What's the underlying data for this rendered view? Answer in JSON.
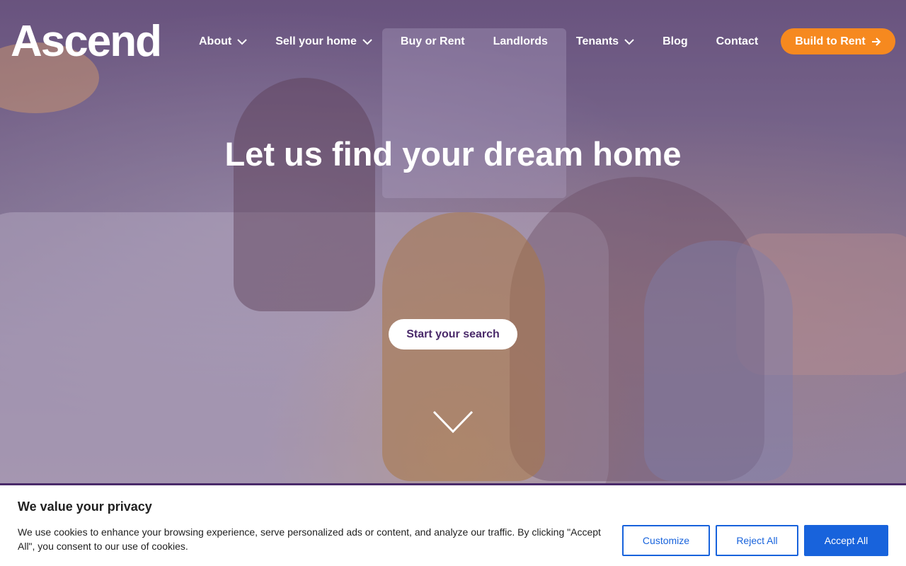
{
  "header": {
    "logo_text": "Ascend",
    "nav": [
      {
        "label": "About",
        "has_dropdown": true
      },
      {
        "label": "Sell your home",
        "has_dropdown": true
      },
      {
        "label": "Buy or Rent",
        "has_dropdown": false
      },
      {
        "label": "Landlords",
        "has_dropdown": false
      },
      {
        "label": "Tenants",
        "has_dropdown": true
      },
      {
        "label": "Blog",
        "has_dropdown": false
      },
      {
        "label": "Contact",
        "has_dropdown": false
      }
    ],
    "cta_label": "Build to Rent"
  },
  "hero": {
    "headline": "Let us find your dream home",
    "search_button": "Start your search",
    "scroll_icon": "chevron-down-icon"
  },
  "cookie_banner": {
    "title": "We value your privacy",
    "text": "We use cookies to enhance your browsing experience, serve personalized ads or content, and analyze our traffic. By clicking \"Accept All\", you consent to our use of cookies.",
    "customize_label": "Customize",
    "reject_label": "Reject All",
    "accept_label": "Accept All"
  },
  "colors": {
    "accent_orange": "#f6891f",
    "brand_purple": "#4a2a6a",
    "button_blue": "#1863dc"
  }
}
